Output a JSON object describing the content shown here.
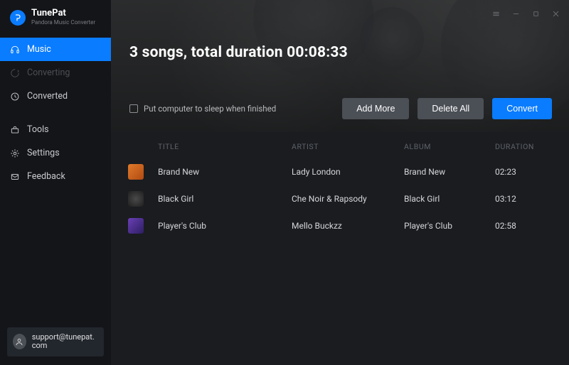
{
  "brand": {
    "name": "TunePat",
    "subtitle": "Pandora Music Converter"
  },
  "sidebar": {
    "items": [
      {
        "label": "Music",
        "icon": "headphones-icon",
        "active": true
      },
      {
        "label": "Converting",
        "icon": "spinner-icon",
        "dim": true
      },
      {
        "label": "Converted",
        "icon": "clock-icon"
      }
    ],
    "items2": [
      {
        "label": "Tools",
        "icon": "toolbox-icon"
      },
      {
        "label": "Settings",
        "icon": "gear-icon"
      },
      {
        "label": "Feedback",
        "icon": "mail-icon"
      }
    ]
  },
  "support": {
    "email": "support@tunepat.com"
  },
  "header": {
    "summary": "3 songs, total duration 00:08:33",
    "sleep_label": "Put computer to sleep when finished",
    "buttons": {
      "add_more": "Add More",
      "delete_all": "Delete All",
      "convert": "Convert"
    }
  },
  "columns": {
    "title": "TITLE",
    "artist": "ARTIST",
    "album": "ALBUM",
    "duration": "DURATION"
  },
  "tracks": [
    {
      "title": "Brand New",
      "artist": "Lady London",
      "album": "Brand New",
      "duration": "02:23"
    },
    {
      "title": "Black Girl",
      "artist": "Che Noir & Rapsody",
      "album": "Black Girl",
      "duration": "03:12"
    },
    {
      "title": "Player's Club",
      "artist": "Mello Buckzz",
      "album": "Player's Club",
      "duration": "02:58"
    }
  ]
}
